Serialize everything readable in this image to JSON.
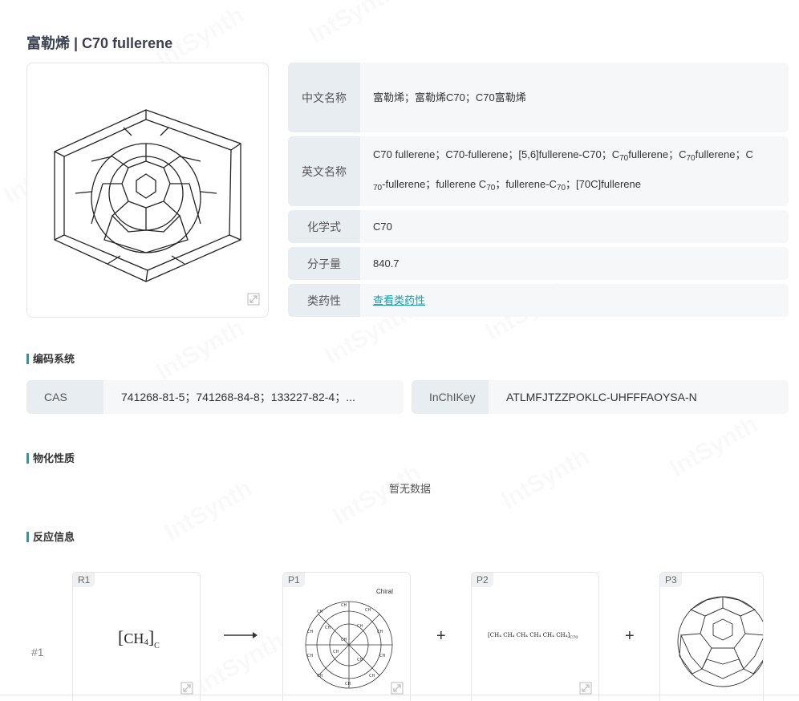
{
  "page": {
    "title": "富勒烯 | C70 fullerene",
    "watermark": "IntSynth"
  },
  "info": {
    "cn_name": {
      "label": "中文名称",
      "value": "富勒烯；富勒烯C70；C70富勒烯"
    },
    "en_name": {
      "label": "英文名称",
      "line1_a": "C70 fullerene；C70-fullerene；[5,6]fullerene-C70；C",
      "line1_sub1": "70",
      "line1_b": "fullerene；C",
      "line1_sub2": "70",
      "line1_c": "fullerene；C",
      "line2_sub0": "70",
      "line2_a": "-fullerene；fullerene C",
      "line2_sub1": "70",
      "line2_b": "；fullerene-C",
      "line2_sub2": "70",
      "line2_c": "；[70C]fullerene"
    },
    "formula": {
      "label": "化学式",
      "value": "C70"
    },
    "mw": {
      "label": "分子量",
      "value": "840.7"
    },
    "druglike": {
      "label": "类药性",
      "link": "查看类药性"
    }
  },
  "sections": {
    "encoding": "编码系统",
    "physchem": "物化性质",
    "reaction": "反应信息"
  },
  "codes": {
    "cas_label": "CAS",
    "cas_value": "741268-81-5；741268-84-8；133227-82-4；...",
    "inchikey_label": "InChIKey",
    "inchikey_value": "ATLMFJTZZPOKLC-UHFFFAOYSA-N"
  },
  "physchem": {
    "empty": "暂无数据"
  },
  "reaction": {
    "index": "#1",
    "r1": {
      "tag": "R1",
      "formula": "CH",
      "sub": "4",
      "suffix": "C"
    },
    "p1": {
      "tag": "P1",
      "chiral": "Chiral"
    },
    "p2": {
      "tag": "P2",
      "chain": "[CH₄ CH₄ CH₄ CH₄ CH₄ CH₄]",
      "sub": "C70"
    },
    "p3": {
      "tag": "P3"
    },
    "plus": "+"
  },
  "icons": {
    "expand": "expand-icon",
    "arrow": "arrow-right-icon"
  }
}
